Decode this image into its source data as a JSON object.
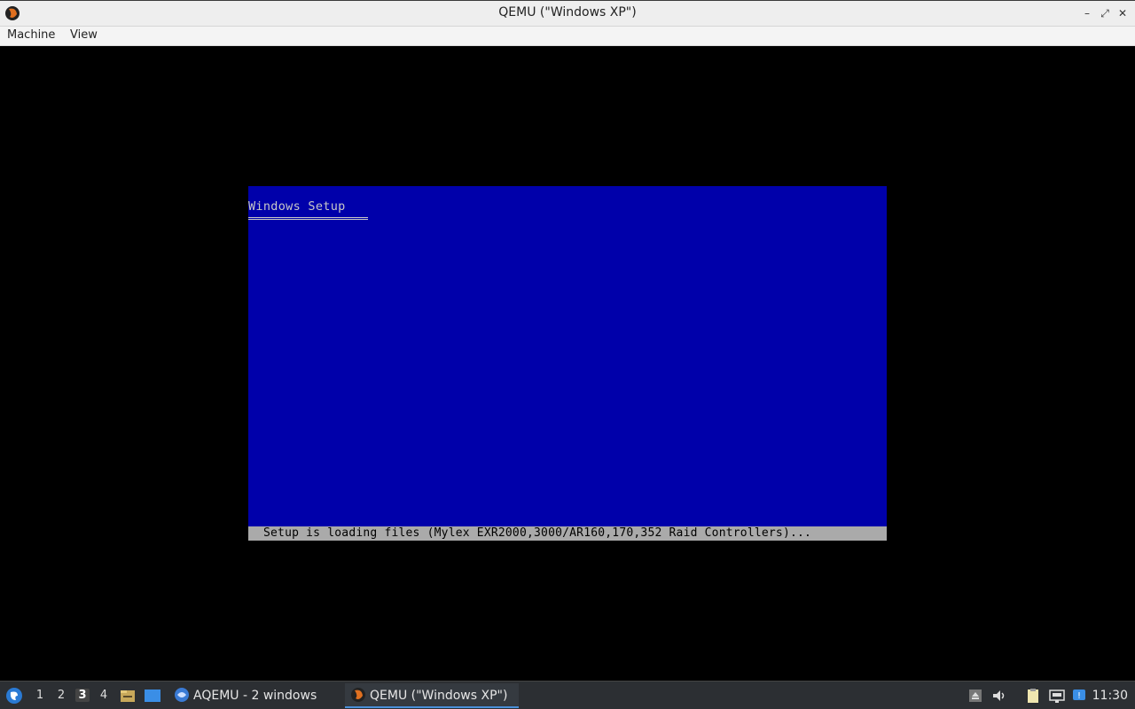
{
  "window": {
    "title": "QEMU (\"Windows XP\")",
    "controls": {
      "minimize": "–",
      "restore": "⤢",
      "close": "✕"
    }
  },
  "menubar": {
    "items": [
      "Machine",
      "View"
    ]
  },
  "vm": {
    "setup_title": "Windows Setup",
    "status_text": "Setup is loading files (Mylex EXR2000,3000/AR160,170,352 Raid Controllers)...",
    "colors": {
      "background": "#0000aa",
      "status_bar": "#aaaaaa",
      "text": "#c8c8c8"
    }
  },
  "taskbar": {
    "workspaces": [
      "1",
      "2",
      "3",
      "4"
    ],
    "active_workspace": "3",
    "tasks": [
      {
        "label": "AQEMU - 2 windows",
        "icon": "aqemu-icon"
      },
      {
        "label": "QEMU (\"Windows XP\")",
        "icon": "qemu-icon"
      }
    ],
    "clock": "11:30"
  }
}
